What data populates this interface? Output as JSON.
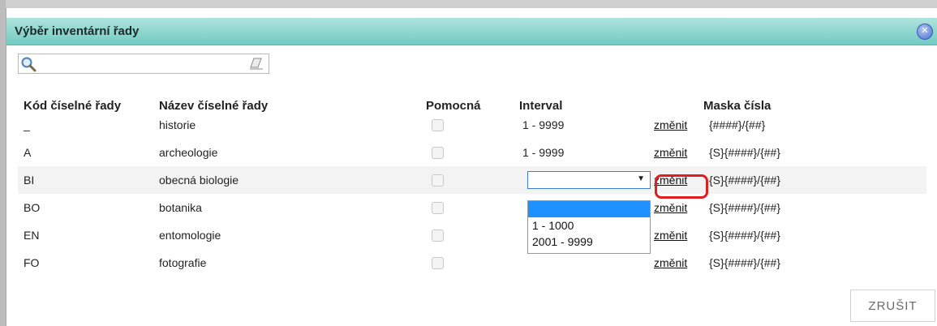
{
  "dialog": {
    "title": "Výběr inventární řady",
    "search": {
      "value": "",
      "placeholder": ""
    },
    "columns": {
      "code": "Kód číselné řady",
      "name": "Název číselné řady",
      "auxiliary": "Pomocná",
      "interval": "Interval",
      "mask": "Maska čísla"
    },
    "rows": [
      {
        "code": "_",
        "name": "historie",
        "auxiliary": false,
        "interval": "1 - 9999",
        "action": "změnit",
        "mask": "{####}/{##}"
      },
      {
        "code": "A",
        "name": "archeologie",
        "auxiliary": false,
        "interval": "1 - 9999",
        "action": "změnit",
        "mask": "{S}{####}/{##}"
      },
      {
        "code": "BI",
        "name": "obecná biologie",
        "auxiliary": false,
        "interval": "",
        "action": "změnit",
        "mask": "{S}{####}/{##}"
      },
      {
        "code": "BO",
        "name": "botanika",
        "auxiliary": false,
        "interval": "",
        "action": "změnit",
        "mask": "{S}{####}/{##}"
      },
      {
        "code": "EN",
        "name": "entomologie",
        "auxiliary": false,
        "interval": "",
        "action": "změnit",
        "mask": "{S}{####}/{##}"
      },
      {
        "code": "FO",
        "name": "fotografie",
        "auxiliary": false,
        "interval": "",
        "action": "změnit",
        "mask": "{S}{####}/{##}"
      }
    ],
    "interval_dropdown": {
      "selected": "",
      "options": [
        "",
        "1 - 1000",
        "2001 - 9999"
      ]
    },
    "cancel_label": "ZRUŠIT",
    "colors": {
      "titlebar": "#73cbc2",
      "dropdown_selected": "#1e90ff",
      "highlight": "#e02020"
    }
  }
}
